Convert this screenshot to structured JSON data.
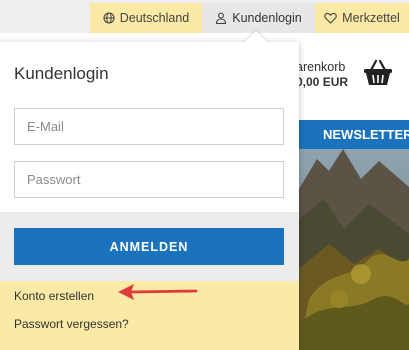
{
  "topbar": {
    "language_label": "Deutschland",
    "login_label": "Kundenlogin",
    "wishlist_label": "Merkzettel",
    "icons": {
      "language": "globe-icon",
      "login": "user-icon",
      "wishlist": "heart-icon"
    }
  },
  "header": {
    "cart_label": "arenkorb",
    "cart_total": "0,00 EUR",
    "cart_icon": "basket-icon",
    "newsletter_label": "NEWSLETTER"
  },
  "login_panel": {
    "title": "Kundenlogin",
    "email_placeholder": "E-Mail",
    "password_placeholder": "Passwort",
    "submit_label": "ANMELDEN",
    "create_account_label": "Konto erstellen",
    "forgot_password_label": "Passwort vergessen?"
  },
  "colors": {
    "accent_blue": "#1b73bd",
    "highlight_yellow": "#fbe9a6",
    "annotation_red": "#e0393b"
  }
}
